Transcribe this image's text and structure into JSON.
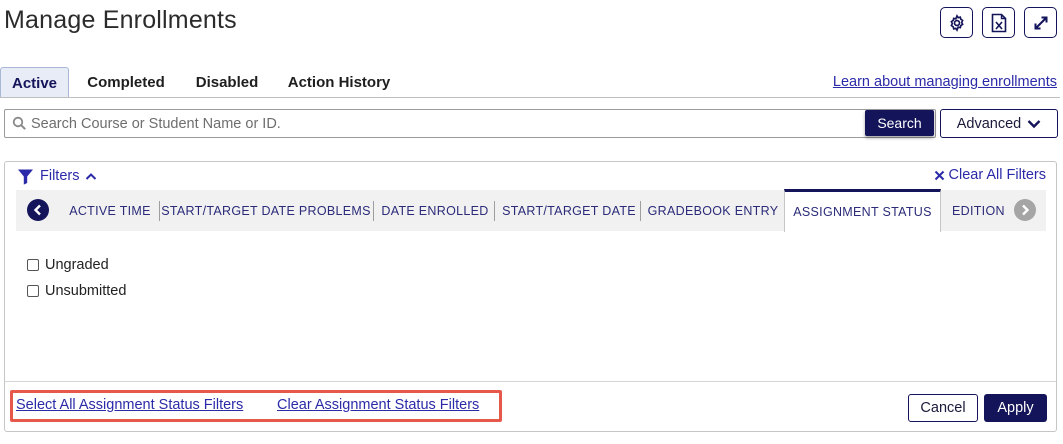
{
  "page": {
    "title": "Manage Enrollments"
  },
  "header_actions": [
    {
      "icon": "gear-icon"
    },
    {
      "icon": "excel-export-icon"
    },
    {
      "icon": "expand-icon"
    }
  ],
  "tabs": {
    "active": "Active",
    "items": [
      "Active",
      "Completed",
      "Disabled",
      "Action History"
    ]
  },
  "learn_link": "Learn about managing enrollments",
  "search": {
    "placeholder": "Search Course or Student Name or ID.",
    "value": "",
    "button": "Search",
    "advanced": "Advanced"
  },
  "filters": {
    "label": "Filters",
    "clear_all": "Clear All Filters",
    "tabs": [
      "ACTIVE TIME",
      "START/TARGET DATE PROBLEMS",
      "DATE ENROLLED",
      "START/TARGET DATE",
      "GRADEBOOK ENTRY",
      "ASSIGNMENT STATUS",
      "EDITION"
    ],
    "active_tab": "ASSIGNMENT STATUS",
    "options": [
      {
        "label": "Ungraded",
        "checked": false
      },
      {
        "label": "Unsubmitted",
        "checked": false
      }
    ],
    "select_all": "Select All Assignment Status Filters",
    "clear_status": "Clear Assignment Status Filters",
    "cancel": "Cancel",
    "apply": "Apply"
  },
  "colors": {
    "brand": "#14145a",
    "link": "#2b2aa8",
    "highlight": "#e5584a"
  }
}
